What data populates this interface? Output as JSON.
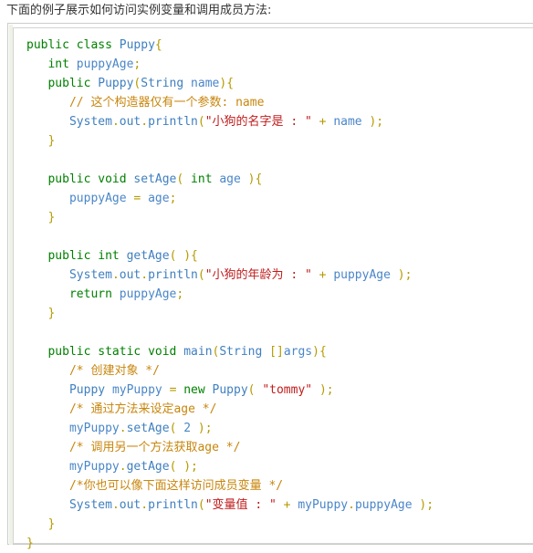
{
  "intro": {
    "text": "下面的例子展示如何访问实例变量和调用成员方法:"
  },
  "colors": {
    "keyword": "#008000",
    "type": "#3f7fbf",
    "identifier": "#4a86c8",
    "string": "#c01c1c",
    "comment": "#c8860d",
    "punctuation": "#b59a00",
    "text": "#333333",
    "code_background": "#ffffff",
    "outer_border": "#cccccc",
    "inner_border": "#d4d4d4",
    "gutter_stripe": "#eef1e6"
  },
  "code_block": {
    "language": "java",
    "lines": [
      [
        {
          "t": "public",
          "c": "kw"
        },
        {
          "t": " ",
          "c": "plain"
        },
        {
          "t": "class",
          "c": "kw"
        },
        {
          "t": " ",
          "c": "plain"
        },
        {
          "t": "Puppy",
          "c": "typ"
        },
        {
          "t": "{",
          "c": "pun"
        }
      ],
      [
        {
          "t": "   ",
          "c": "plain"
        },
        {
          "t": "int",
          "c": "kw"
        },
        {
          "t": " ",
          "c": "plain"
        },
        {
          "t": "puppyAge",
          "c": "id"
        },
        {
          "t": ";",
          "c": "pun"
        }
      ],
      [
        {
          "t": "   ",
          "c": "plain"
        },
        {
          "t": "public",
          "c": "kw"
        },
        {
          "t": " ",
          "c": "plain"
        },
        {
          "t": "Puppy",
          "c": "typ"
        },
        {
          "t": "(",
          "c": "pun"
        },
        {
          "t": "String",
          "c": "typ"
        },
        {
          "t": " ",
          "c": "plain"
        },
        {
          "t": "name",
          "c": "id"
        },
        {
          "t": ")",
          "c": "pun"
        },
        {
          "t": "{",
          "c": "pun"
        }
      ],
      [
        {
          "t": "      ",
          "c": "plain"
        },
        {
          "t": "// 这个构造器仅有一个参数: name",
          "c": "cmt"
        }
      ],
      [
        {
          "t": "      ",
          "c": "plain"
        },
        {
          "t": "System",
          "c": "typ"
        },
        {
          "t": ".",
          "c": "pun"
        },
        {
          "t": "out",
          "c": "typ"
        },
        {
          "t": ".",
          "c": "pun"
        },
        {
          "t": "println",
          "c": "typ"
        },
        {
          "t": "(",
          "c": "pun"
        },
        {
          "t": "\"小狗的名字是 : \"",
          "c": "str"
        },
        {
          "t": " ",
          "c": "plain"
        },
        {
          "t": "+",
          "c": "pun"
        },
        {
          "t": " ",
          "c": "plain"
        },
        {
          "t": "name",
          "c": "id"
        },
        {
          "t": " ",
          "c": "plain"
        },
        {
          "t": ");",
          "c": "pun"
        }
      ],
      [
        {
          "t": "   ",
          "c": "plain"
        },
        {
          "t": "}",
          "c": "pun"
        }
      ],
      [
        {
          "t": "",
          "c": "plain"
        }
      ],
      [
        {
          "t": "   ",
          "c": "plain"
        },
        {
          "t": "public",
          "c": "kw"
        },
        {
          "t": " ",
          "c": "plain"
        },
        {
          "t": "void",
          "c": "kw"
        },
        {
          "t": " ",
          "c": "plain"
        },
        {
          "t": "setAge",
          "c": "typ"
        },
        {
          "t": "( ",
          "c": "pun"
        },
        {
          "t": "int",
          "c": "kw"
        },
        {
          "t": " ",
          "c": "plain"
        },
        {
          "t": "age",
          "c": "id"
        },
        {
          "t": " ",
          "c": "plain"
        },
        {
          "t": ")",
          "c": "pun"
        },
        {
          "t": "{",
          "c": "pun"
        }
      ],
      [
        {
          "t": "      ",
          "c": "plain"
        },
        {
          "t": "puppyAge",
          "c": "id"
        },
        {
          "t": " ",
          "c": "plain"
        },
        {
          "t": "=",
          "c": "pun"
        },
        {
          "t": " ",
          "c": "plain"
        },
        {
          "t": "age",
          "c": "id"
        },
        {
          "t": ";",
          "c": "pun"
        }
      ],
      [
        {
          "t": "   ",
          "c": "plain"
        },
        {
          "t": "}",
          "c": "pun"
        }
      ],
      [
        {
          "t": "",
          "c": "plain"
        }
      ],
      [
        {
          "t": "   ",
          "c": "plain"
        },
        {
          "t": "public",
          "c": "kw"
        },
        {
          "t": " ",
          "c": "plain"
        },
        {
          "t": "int",
          "c": "kw"
        },
        {
          "t": " ",
          "c": "plain"
        },
        {
          "t": "getAge",
          "c": "typ"
        },
        {
          "t": "( ",
          "c": "pun"
        },
        {
          "t": ")",
          "c": "pun"
        },
        {
          "t": "{",
          "c": "pun"
        }
      ],
      [
        {
          "t": "      ",
          "c": "plain"
        },
        {
          "t": "System",
          "c": "typ"
        },
        {
          "t": ".",
          "c": "pun"
        },
        {
          "t": "out",
          "c": "typ"
        },
        {
          "t": ".",
          "c": "pun"
        },
        {
          "t": "println",
          "c": "typ"
        },
        {
          "t": "(",
          "c": "pun"
        },
        {
          "t": "\"小狗的年龄为 : \"",
          "c": "str"
        },
        {
          "t": " ",
          "c": "plain"
        },
        {
          "t": "+",
          "c": "pun"
        },
        {
          "t": " ",
          "c": "plain"
        },
        {
          "t": "puppyAge",
          "c": "id"
        },
        {
          "t": " ",
          "c": "plain"
        },
        {
          "t": ");",
          "c": "pun"
        }
      ],
      [
        {
          "t": "      ",
          "c": "plain"
        },
        {
          "t": "return",
          "c": "kw"
        },
        {
          "t": " ",
          "c": "plain"
        },
        {
          "t": "puppyAge",
          "c": "id"
        },
        {
          "t": ";",
          "c": "pun"
        }
      ],
      [
        {
          "t": "   ",
          "c": "plain"
        },
        {
          "t": "}",
          "c": "pun"
        }
      ],
      [
        {
          "t": "",
          "c": "plain"
        }
      ],
      [
        {
          "t": "   ",
          "c": "plain"
        },
        {
          "t": "public",
          "c": "kw"
        },
        {
          "t": " ",
          "c": "plain"
        },
        {
          "t": "static",
          "c": "kw"
        },
        {
          "t": " ",
          "c": "plain"
        },
        {
          "t": "void",
          "c": "kw"
        },
        {
          "t": " ",
          "c": "plain"
        },
        {
          "t": "main",
          "c": "typ"
        },
        {
          "t": "(",
          "c": "pun"
        },
        {
          "t": "String",
          "c": "typ"
        },
        {
          "t": " ",
          "c": "plain"
        },
        {
          "t": "[]",
          "c": "pun"
        },
        {
          "t": "args",
          "c": "id"
        },
        {
          "t": ")",
          "c": "pun"
        },
        {
          "t": "{",
          "c": "pun"
        }
      ],
      [
        {
          "t": "      ",
          "c": "plain"
        },
        {
          "t": "/* 创建对象 */",
          "c": "cmt"
        }
      ],
      [
        {
          "t": "      ",
          "c": "plain"
        },
        {
          "t": "Puppy",
          "c": "typ"
        },
        {
          "t": " ",
          "c": "plain"
        },
        {
          "t": "myPuppy",
          "c": "id"
        },
        {
          "t": " ",
          "c": "plain"
        },
        {
          "t": "=",
          "c": "pun"
        },
        {
          "t": " ",
          "c": "plain"
        },
        {
          "t": "new",
          "c": "kw"
        },
        {
          "t": " ",
          "c": "plain"
        },
        {
          "t": "Puppy",
          "c": "typ"
        },
        {
          "t": "( ",
          "c": "pun"
        },
        {
          "t": "\"tommy\"",
          "c": "str"
        },
        {
          "t": " ",
          "c": "plain"
        },
        {
          "t": ");",
          "c": "pun"
        }
      ],
      [
        {
          "t": "      ",
          "c": "plain"
        },
        {
          "t": "/* 通过方法来设定age */",
          "c": "cmt"
        }
      ],
      [
        {
          "t": "      ",
          "c": "plain"
        },
        {
          "t": "myPuppy",
          "c": "id"
        },
        {
          "t": ".",
          "c": "pun"
        },
        {
          "t": "setAge",
          "c": "typ"
        },
        {
          "t": "( ",
          "c": "pun"
        },
        {
          "t": "2",
          "c": "num"
        },
        {
          "t": " ",
          "c": "plain"
        },
        {
          "t": ");",
          "c": "pun"
        }
      ],
      [
        {
          "t": "      ",
          "c": "plain"
        },
        {
          "t": "/* 调用另一个方法获取age */",
          "c": "cmt"
        }
      ],
      [
        {
          "t": "      ",
          "c": "plain"
        },
        {
          "t": "myPuppy",
          "c": "id"
        },
        {
          "t": ".",
          "c": "pun"
        },
        {
          "t": "getAge",
          "c": "typ"
        },
        {
          "t": "( ",
          "c": "pun"
        },
        {
          "t": ");",
          "c": "pun"
        }
      ],
      [
        {
          "t": "      ",
          "c": "plain"
        },
        {
          "t": "/*你也可以像下面这样访问成员变量 */",
          "c": "cmt"
        }
      ],
      [
        {
          "t": "      ",
          "c": "plain"
        },
        {
          "t": "System",
          "c": "typ"
        },
        {
          "t": ".",
          "c": "pun"
        },
        {
          "t": "out",
          "c": "typ"
        },
        {
          "t": ".",
          "c": "pun"
        },
        {
          "t": "println",
          "c": "typ"
        },
        {
          "t": "(",
          "c": "pun"
        },
        {
          "t": "\"变量值 : \"",
          "c": "str"
        },
        {
          "t": " ",
          "c": "plain"
        },
        {
          "t": "+",
          "c": "pun"
        },
        {
          "t": " ",
          "c": "plain"
        },
        {
          "t": "myPuppy",
          "c": "id"
        },
        {
          "t": ".",
          "c": "pun"
        },
        {
          "t": "puppyAge",
          "c": "id"
        },
        {
          "t": " ",
          "c": "plain"
        },
        {
          "t": ");",
          "c": "pun"
        }
      ],
      [
        {
          "t": "   ",
          "c": "plain"
        },
        {
          "t": "}",
          "c": "pun"
        }
      ],
      [
        {
          "t": "}",
          "c": "pun"
        }
      ]
    ],
    "plain_text": "public class Puppy{\n   int puppyAge;\n   public Puppy(String name){\n      // 这个构造器仅有一个参数: name\n      System.out.println(\"小狗的名字是 : \" + name );\n   }\n\n   public void setAge( int age ){\n      puppyAge = age;\n   }\n\n   public int getAge( ){\n      System.out.println(\"小狗的年龄为 : \" + puppyAge );\n      return puppyAge;\n   }\n\n   public static void main(String []args){\n      /* 创建对象 */\n      Puppy myPuppy = new Puppy( \"tommy\" );\n      /* 通过方法来设定age */\n      myPuppy.setAge( 2 );\n      /* 调用另一个方法获取age */\n      myPuppy.getAge( );\n      /*你也可以像下面这样访问成员变量 */\n      System.out.println(\"变量值 : \" + myPuppy.puppyAge );\n   }\n}"
  }
}
